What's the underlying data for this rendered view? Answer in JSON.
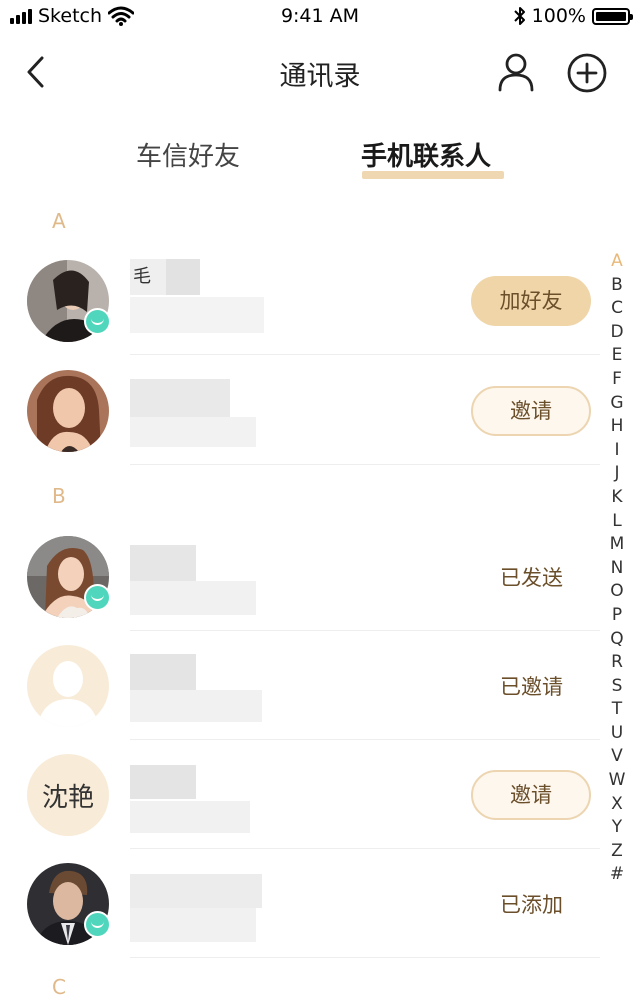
{
  "status_bar": {
    "carrier": "Sketch",
    "time": "9:41 AM",
    "battery": "100%",
    "icons": [
      "signal-icon",
      "wifi-icon",
      "bluetooth-icon",
      "battery-icon"
    ]
  },
  "nav": {
    "title": "通讯录",
    "icons": [
      "back-icon",
      "person-icon",
      "add-icon"
    ]
  },
  "tabs": {
    "friends": "车信好友",
    "phone_contacts": "手机联系人",
    "active": "phone_contacts"
  },
  "sections": {
    "a": "A",
    "b": "B",
    "c": "C"
  },
  "contacts": [
    {
      "name_visible": "毛",
      "action": "加好友",
      "action_style": "filled",
      "badge": true
    },
    {
      "name_visible": "",
      "action": "邀请",
      "action_style": "outline",
      "badge": false
    },
    {
      "name_visible": "",
      "action": "已发送",
      "action_style": "text",
      "badge": true
    },
    {
      "name_visible": "",
      "action": "已邀请",
      "action_style": "text",
      "badge": false
    },
    {
      "avatar_text": "沈艳",
      "action": "邀请",
      "action_style": "outline",
      "badge": false
    },
    {
      "name_visible": "",
      "action": "已添加",
      "action_style": "text",
      "badge": true
    }
  ],
  "index": {
    "letters": [
      "A",
      "B",
      "C",
      "D",
      "E",
      "F",
      "G",
      "H",
      "I",
      "J",
      "K",
      "L",
      "M",
      "N",
      "O",
      "P",
      "Q",
      "R",
      "S",
      "T",
      "U",
      "V",
      "W",
      "X",
      "Y",
      "Z",
      "#"
    ],
    "active": "A"
  },
  "colors": {
    "accent": "#e0b98a",
    "button_fill": "#efd5a8",
    "badge": "#4fd6bc",
    "text_action": "#6b4f2b"
  }
}
